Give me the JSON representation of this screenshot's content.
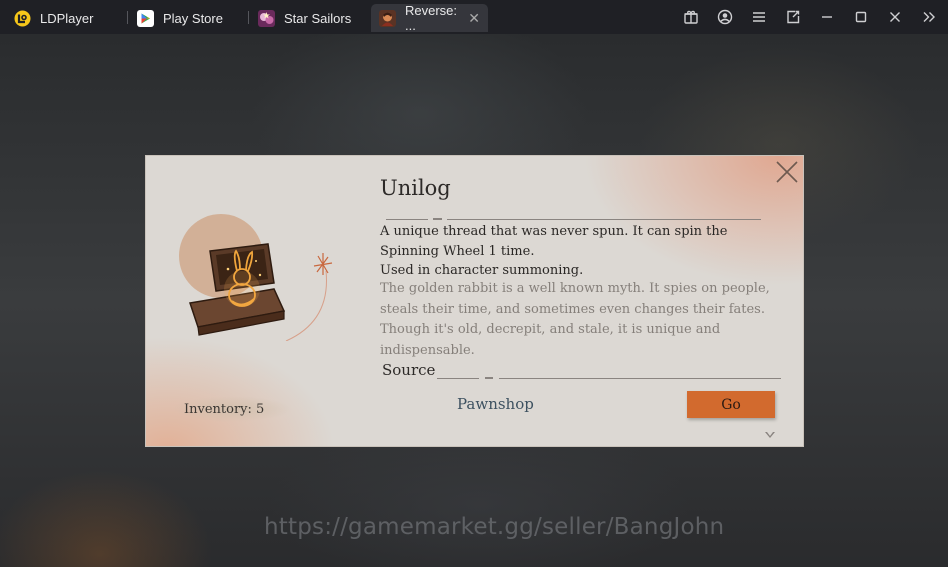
{
  "window": {
    "tabs": [
      {
        "label": "LDPlayer",
        "icon": "ldplayer-logo-icon"
      },
      {
        "label": "Play Store",
        "icon": "play-store-icon"
      },
      {
        "label": "Star Sailors",
        "icon": "star-sailors-icon"
      },
      {
        "label": "Reverse: ...",
        "icon": "reverse-game-icon",
        "active": true
      }
    ],
    "controls": [
      "store-icon",
      "account-icon",
      "menu-icon",
      "sync-icon",
      "minimize-icon",
      "maximize-icon",
      "close-icon",
      "expand-sidebar-icon"
    ]
  },
  "dialog": {
    "title": "Unilog",
    "description_lines": [
      "A unique thread that was never spun. It can spin the",
      "Spinning Wheel 1 time.",
      "Used in character summoning."
    ],
    "flavor_lines": [
      "The golden rabbit is a well known myth. It spies on people,",
      "steals their time, and sometimes even changes their fates.",
      "Though it's old, decrepit, and stale, it is unique and",
      "indispensable."
    ],
    "source_label": "Source",
    "source_item": "Pawnshop",
    "go_button": "Go",
    "inventory": "Inventory: 5"
  },
  "watermark": "https://gamemarket.gg/seller/BangJohn",
  "colors": {
    "titlebar": "#1f2025",
    "active_tab": "#35363c",
    "dialog_bg": "#dcd8d3",
    "accent_orange": "#d26a2e",
    "source_link": "#3d5160"
  }
}
